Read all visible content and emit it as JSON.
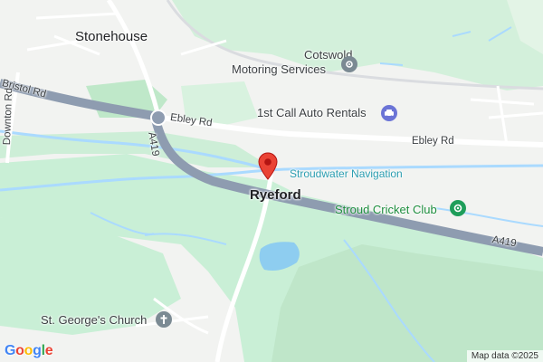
{
  "map": {
    "places": {
      "stonehouse": "Stonehouse",
      "ryeford": "Ryeford"
    },
    "roads": {
      "bristol_rd": "Bristol Rd",
      "downton_rd": "Downton Rd",
      "ebley_rd_west": "Ebley Rd",
      "ebley_rd_east": "Ebley Rd",
      "a419_vertical": "A419",
      "a419_east": "A419"
    },
    "waterways": {
      "stroudwater": "Stroudwater Navigation"
    },
    "pois": {
      "cotswold_line1": "Cotswold",
      "cotswold_line2": "Motoring Services",
      "auto_rentals": "1st Call Auto Rentals",
      "cricket_club": "Stroud Cricket Club",
      "church": "St. George's Church"
    },
    "icons": {
      "cotswold": "car-repair-icon",
      "auto_rentals": "car-rental-icon",
      "cricket_club": "sports-icon",
      "church": "church-icon",
      "pin": "location-pin-icon"
    },
    "branding": {
      "logo_letters": [
        "G",
        "o",
        "o",
        "g",
        "l",
        "e"
      ],
      "attribution": "Map data ©2025"
    },
    "colors": {
      "land": "#f2f3f1",
      "green": "#cfeed9",
      "water": "#aadaff",
      "major_road": "#8e9cb0",
      "road": "#ffffff",
      "pin": "#ea4335"
    }
  }
}
